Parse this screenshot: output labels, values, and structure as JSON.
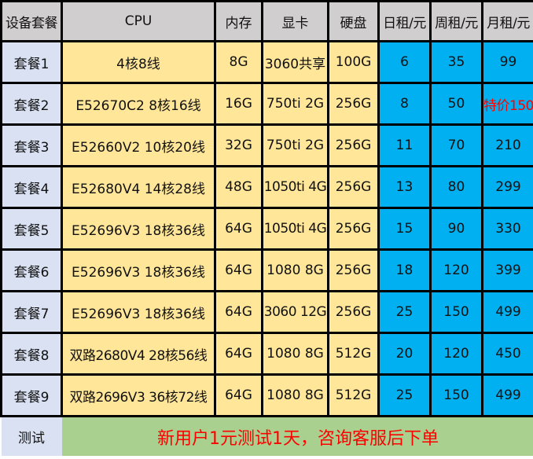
{
  "table": {
    "headers": [
      "设备套餐",
      "CPU",
      "内存",
      "显卡",
      "硬盘",
      "日租/元",
      "周租/元",
      "月租/元"
    ],
    "rows": [
      {
        "name": "套餐1",
        "cpu": "4核8线",
        "ram": "8G",
        "gpu": "3060共享",
        "disk": "100G",
        "daily": "6",
        "weekly": "35",
        "monthly": "99"
      },
      {
        "name": "套餐2",
        "cpu": "E52670C2 8核16线",
        "ram": "16G",
        "gpu": "750ti 2G",
        "disk": "256G",
        "daily": "8",
        "weekly": "50",
        "monthly": "特价150"
      },
      {
        "name": "套餐3",
        "cpu": "E52660V2 10核20线",
        "ram": "32G",
        "gpu": "750ti 2G",
        "disk": "256G",
        "daily": "11",
        "weekly": "70",
        "monthly": "210"
      },
      {
        "name": "套餐4",
        "cpu": "E52680V4 14核28线",
        "ram": "48G",
        "gpu": "1050ti 4G",
        "disk": "256G",
        "daily": "13",
        "weekly": "80",
        "monthly": "299"
      },
      {
        "name": "套餐5",
        "cpu": "E52696V3 18核36线",
        "ram": "64G",
        "gpu": "1050ti 4G",
        "disk": "256G",
        "daily": "15",
        "weekly": "90",
        "monthly": "330"
      },
      {
        "name": "套餐6",
        "cpu": "E52696V3 18核36线",
        "ram": "64G",
        "gpu": "1080 8G",
        "disk": "256G",
        "daily": "18",
        "weekly": "120",
        "monthly": "399"
      },
      {
        "name": "套餐7",
        "cpu": "E52696V3 18核36线",
        "ram": "64G",
        "gpu": "3060 12G",
        "disk": "256G",
        "daily": "25",
        "weekly": "150",
        "monthly": "499"
      },
      {
        "name": "套餐8",
        "cpu": "双路2680V4 28核56线",
        "ram": "64G",
        "gpu": "1080 8G",
        "disk": "512G",
        "daily": "20",
        "weekly": "120",
        "monthly": "450"
      },
      {
        "name": "套餐9",
        "cpu": "双路2696V3 36核72线",
        "ram": "64G",
        "gpu": "1080 8G",
        "disk": "512G",
        "daily": "25",
        "weekly": "150",
        "monthly": "499"
      }
    ],
    "test_row": {
      "label": "测试",
      "message": "新用户1元测试1天，咨询客服后下单"
    }
  },
  "colors": {
    "header_bg": "#d0cece",
    "name_bg": "#d9e1f2",
    "spec_bg": "#ffe699",
    "price_bg": "#00b0f0",
    "promo_bg": "#a9d08e",
    "highlight_text": "#ff0000"
  }
}
